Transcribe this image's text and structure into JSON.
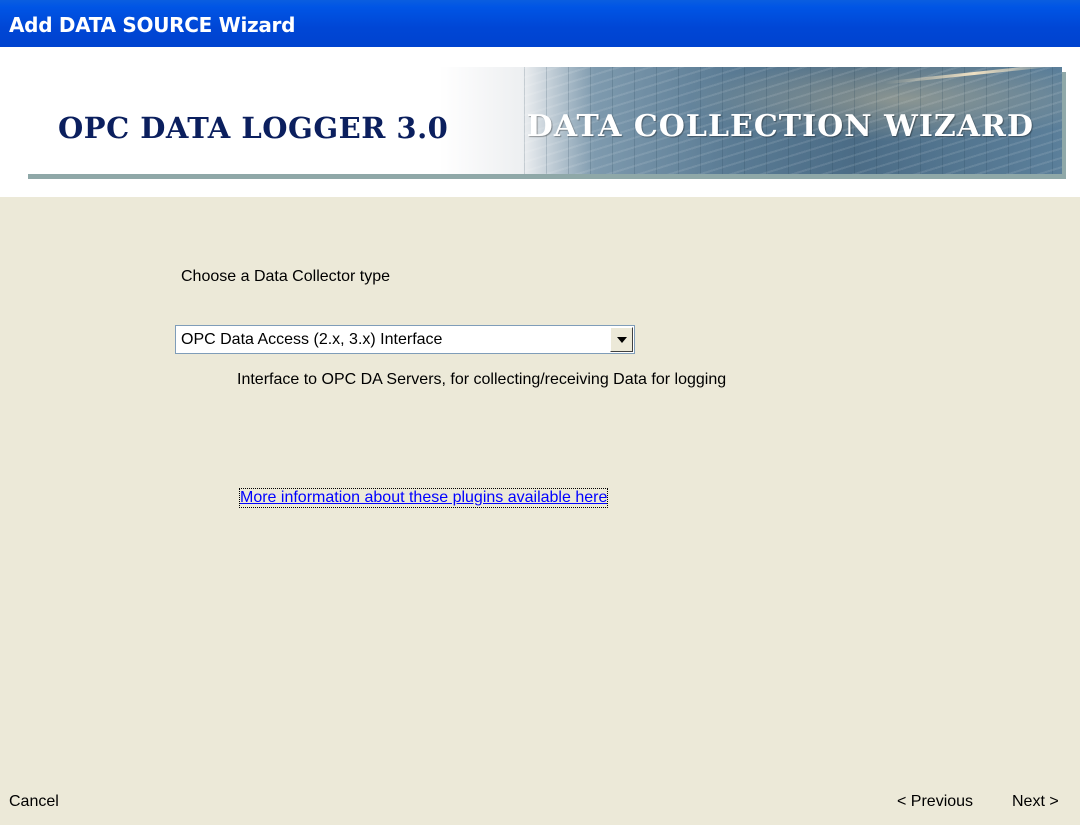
{
  "window": {
    "title": "Add DATA SOURCE Wizard"
  },
  "banner": {
    "product_name": "OPC DATA LOGGER 3.0",
    "wizard_name": "DATA COLLECTION WIZARD"
  },
  "main": {
    "prompt": "Choose a Data Collector type",
    "collector_select": {
      "selected": "OPC Data Access (2.x, 3.x) Interface"
    },
    "description": "Interface to OPC DA Servers, for collecting/receiving Data for logging",
    "more_info_link": "More information about these plugins available here"
  },
  "footer": {
    "cancel_label": "Cancel",
    "previous_label": "< Previous",
    "next_label": "Next >"
  },
  "colors": {
    "title_bar": "#0046D5",
    "dialog_background": "#ECE9D8",
    "link": "#0000FF",
    "banner_left_text": "#0B1F5E"
  }
}
